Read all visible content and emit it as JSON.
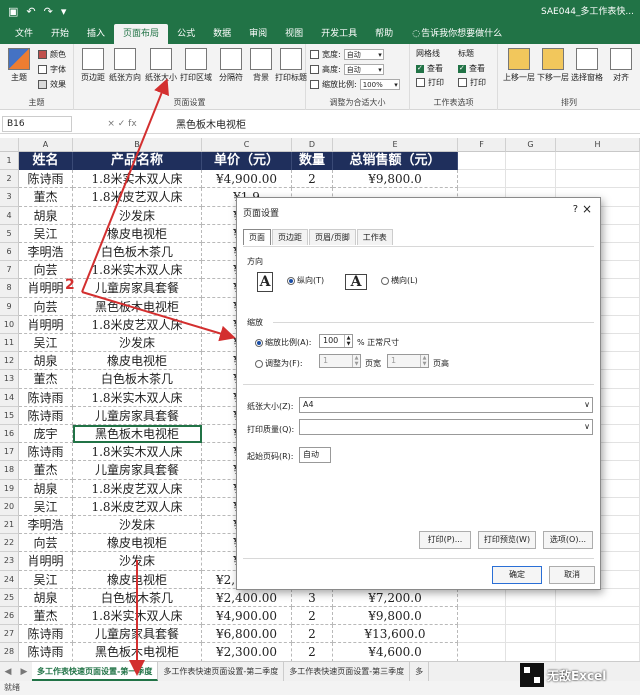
{
  "window": {
    "doc_title": "SAE044_多工作表快..."
  },
  "ribbon_tabs": [
    "文件",
    "开始",
    "插入",
    "页面布局",
    "公式",
    "数据",
    "审阅",
    "视图",
    "开发工具",
    "帮助"
  ],
  "active_tab_index": 3,
  "tell_me": "告诉我你想要做什么",
  "ribbon": {
    "themes": {
      "big": "主题",
      "colors": "颜色",
      "fonts": "字体",
      "effects": "效果",
      "label": "主题"
    },
    "page_setup": {
      "margins": "页边距",
      "orientation": "纸张方向",
      "size": "纸张大小",
      "print_area": "打印区域",
      "breaks": "分隔符",
      "background": "背景",
      "print_titles": "打印标题",
      "label": "页面设置"
    },
    "scale": {
      "width": "宽度:",
      "width_val": "自动",
      "height": "高度:",
      "height_val": "自动",
      "scale": "缩放比例:",
      "scale_val": "100%",
      "label": "调整为合适大小"
    },
    "sheet_options": {
      "gridlines": "网格线",
      "headings": "标题",
      "view1": "查看",
      "view2": "查看",
      "print1": "打印",
      "print2": "打印",
      "label": "工作表选项"
    },
    "arrange": {
      "forward": "上移一层",
      "backward": "下移一层",
      "pane": "选择窗格",
      "align": "对齐",
      "label": "排列"
    }
  },
  "formula_bar": {
    "name_box": "B16",
    "fx": "× ✓ fx",
    "value": "黑色板木电视柜"
  },
  "columns": [
    "A",
    "B",
    "C",
    "D",
    "E",
    "F",
    "G",
    "H"
  ],
  "header_row": [
    "姓名",
    "产品名称",
    "单价（元）",
    "数量",
    "总销售额（元）"
  ],
  "rows": [
    [
      "陈诗雨",
      "1.8米实木双人床",
      "¥4,900.00",
      "2",
      "¥9,800.0"
    ],
    [
      "董杰",
      "1.8米皮艺双人床",
      "¥1,9",
      "",
      ""
    ],
    [
      "胡泉",
      "沙发床",
      "¥1,9",
      "",
      ""
    ],
    [
      "吴江",
      "橡皮电视柜",
      "¥2,5",
      "",
      ""
    ],
    [
      "李明浩",
      "白色板木茶几",
      "¥2,4",
      "",
      ""
    ],
    [
      "向芸",
      "1.8米实木双人床",
      "¥4,9",
      "",
      ""
    ],
    [
      "肖明明",
      "儿童房家具套餐",
      "¥6,8",
      "",
      ""
    ],
    [
      "向芸",
      "黑色板木电视柜",
      "¥2,3",
      "",
      ""
    ],
    [
      "肖明明",
      "1.8米皮艺双人床",
      "¥1,9",
      "",
      ""
    ],
    [
      "吴江",
      "沙发床",
      "¥1,9",
      "",
      ""
    ],
    [
      "胡泉",
      "橡皮电视柜",
      "¥2,5",
      "",
      ""
    ],
    [
      "董杰",
      "白色板木茶几",
      "¥2,4",
      "",
      ""
    ],
    [
      "陈诗雨",
      "1.8米实木双人床",
      "¥4,9",
      "",
      ""
    ],
    [
      "陈诗雨",
      "儿童房家具套餐",
      "¥6,8",
      "",
      ""
    ],
    [
      "庞宇",
      "黑色板木电视柜",
      "¥2,3",
      "",
      ""
    ],
    [
      "陈诗雨",
      "1.8米实木双人床",
      "¥4,9",
      "",
      ""
    ],
    [
      "董杰",
      "儿童房家具套餐",
      "¥6,8",
      "",
      ""
    ],
    [
      "胡泉",
      "1.8米皮艺双人床",
      "¥1,9",
      "",
      ""
    ],
    [
      "吴江",
      "1.8米皮艺双人床",
      "¥1,9",
      "",
      ""
    ],
    [
      "李明浩",
      "沙发床",
      "¥1,9",
      "",
      ""
    ],
    [
      "向芸",
      "橡皮电视柜",
      "¥2,5",
      "",
      ""
    ],
    [
      "肖明明",
      "沙发床",
      "¥1,9",
      "",
      ""
    ],
    [
      "吴江",
      "橡皮电视柜",
      "¥2,500.00",
      "3",
      "¥7,500.0"
    ],
    [
      "胡泉",
      "白色板木茶几",
      "¥2,400.00",
      "3",
      "¥7,200.0"
    ],
    [
      "董杰",
      "1.8米实木双人床",
      "¥4,900.00",
      "2",
      "¥9,800.0"
    ],
    [
      "陈诗雨",
      "儿童房家具套餐",
      "¥6,800.00",
      "2",
      "¥13,600.0"
    ],
    [
      "陈诗雨",
      "黑色板木电视柜",
      "¥2,300.00",
      "2",
      "¥4,600.0"
    ]
  ],
  "sheet_tabs": [
    "多工作表快速页面设置-第一季度",
    "多工作表快速页面设置-第二季度",
    "多工作表快速页面设置-第三季度",
    "多"
  ],
  "status": "就绪",
  "dialog": {
    "title": "页面设置",
    "help": "?",
    "close": "×",
    "tabs": [
      "页面",
      "页边距",
      "页眉/页脚",
      "工作表"
    ],
    "orientation_label": "方向",
    "portrait": "纵向(T)",
    "landscape": "横向(L)",
    "page_icon": "A",
    "scaling_label": "缩放",
    "adjust_to": "缩放比例(A):",
    "adjust_val": "100",
    "adjust_unit": "% 正常尺寸",
    "fit_to": "调整为(F):",
    "fit_w": "1",
    "fit_w_unit": "页宽",
    "fit_h": "1",
    "fit_h_unit": "页高",
    "paper_size_label": "纸张大小(Z):",
    "paper_size": "A4",
    "quality_label": "打印质量(Q):",
    "quality": "",
    "first_page_label": "起始页码(R):",
    "first_page": "自动",
    "print_btn": "打印(P)...",
    "preview_btn": "打印预览(W)",
    "options_btn": "选项(O)...",
    "ok": "确定",
    "cancel": "取消"
  },
  "annotation": {
    "step_number": "2",
    "arrow_color": "#d32f2f"
  },
  "watermark": "无敌Excel"
}
